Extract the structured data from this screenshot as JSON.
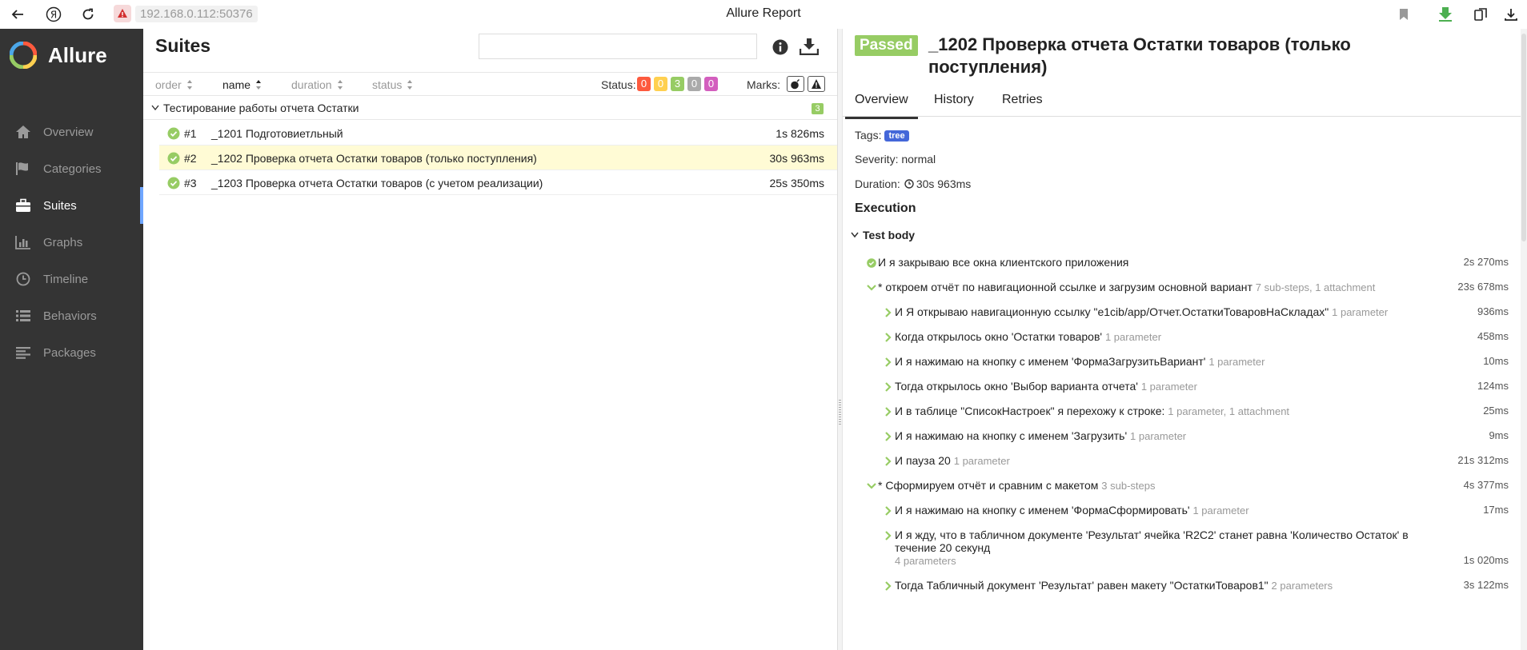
{
  "browser": {
    "address": "192.168.0.112:50376",
    "page_title": "Allure Report"
  },
  "sidebar": {
    "logo": "Allure",
    "items": [
      {
        "label": "Overview",
        "icon": "home-icon"
      },
      {
        "label": "Categories",
        "icon": "flag-icon"
      },
      {
        "label": "Suites",
        "icon": "briefcase-icon",
        "active": true
      },
      {
        "label": "Graphs",
        "icon": "bar-chart-icon"
      },
      {
        "label": "Timeline",
        "icon": "clock-icon"
      },
      {
        "label": "Behaviors",
        "icon": "list-icon"
      },
      {
        "label": "Packages",
        "icon": "align-left-icon"
      }
    ]
  },
  "suites": {
    "title": "Suites",
    "search_placeholder": "",
    "sort": {
      "order": "order",
      "name": "name",
      "duration": "duration",
      "status": "status"
    },
    "status_label": "Status:",
    "status_counts": [
      {
        "value": "0",
        "color": "#fd5a3e"
      },
      {
        "value": "0",
        "color": "#ffd050"
      },
      {
        "value": "3",
        "color": "#97cc64"
      },
      {
        "value": "0",
        "color": "#aaaaaa"
      },
      {
        "value": "0",
        "color": "#d35ebe"
      }
    ],
    "marks_label": "Marks:",
    "group": {
      "title": "Тестирование работы отчета Остатки",
      "count": "3"
    },
    "tests": [
      {
        "num": "#1",
        "name": "_1201 Подготовиетльный",
        "duration": "1s 826ms"
      },
      {
        "num": "#2",
        "name": "_1202 Проверка отчета Остатки товаров (только поступления)",
        "duration": "30s 963ms"
      },
      {
        "num": "#3",
        "name": "_1203 Проверка отчета Остатки товаров (с учетом реализации)",
        "duration": "25s 350ms"
      }
    ]
  },
  "result": {
    "status": "Passed",
    "title": "_1202 Проверка отчета Остатки товаров (только поступления)",
    "tabs": [
      "Overview",
      "History",
      "Retries"
    ],
    "tags_label": "Tags:",
    "tag": "tree",
    "severity": "Severity: normal",
    "duration_label": "Duration:",
    "duration": "30s 963ms",
    "execution": "Execution",
    "test_body": "Test body",
    "steps": [
      {
        "text": "И я закрываю все окна клиентского приложения",
        "sub": "",
        "dur": "2s 270ms"
      },
      {
        "text": "* откроем отчёт по навигационной ссылке и загрузим основной вариант",
        "sub": "7 sub-steps, 1 attachment",
        "dur": "23s 678ms"
      },
      {
        "text": "И Я открываю навигационную ссылку \"e1cib/app/Отчет.ОстаткиТоваровНаСкладах\"",
        "sub": "1 parameter",
        "dur": "936ms"
      },
      {
        "text": "Когда открылось окно 'Остатки товаров'",
        "sub": "1 parameter",
        "dur": "458ms"
      },
      {
        "text": "И я нажимаю на кнопку с именем 'ФормаЗагрузитьВариант'",
        "sub": "1 parameter",
        "dur": "10ms"
      },
      {
        "text": "Тогда открылось окно 'Выбор варианта отчета'",
        "sub": "1 parameter",
        "dur": "124ms"
      },
      {
        "text": "И в таблице \"СписокНастроек\" я перехожу к строке:",
        "sub": "1 parameter, 1 attachment",
        "dur": "25ms"
      },
      {
        "text": "И я нажимаю на кнопку с именем 'Загрузить'",
        "sub": "1 parameter",
        "dur": "9ms"
      },
      {
        "text": "И пауза 20",
        "sub": "1 parameter",
        "dur": "21s 312ms"
      },
      {
        "text": "* Сформируем отчёт и сравним с макетом",
        "sub": "3 sub-steps",
        "dur": "4s 377ms"
      },
      {
        "text": "И я нажимаю на кнопку с именем 'ФормаСформировать'",
        "sub": "1 parameter",
        "dur": "17ms"
      },
      {
        "text": "И я жду, что в табличном документе 'Результат' ячейка 'R2C2' станет равна 'Количество Остаток' в течение 20 секунд",
        "sub": "4 parameters",
        "dur": "1s 020ms"
      },
      {
        "text": "Тогда Табличный документ 'Результат' равен макету \"ОстаткиТоваров1\"",
        "sub": "2 parameters",
        "dur": "3s 122ms"
      }
    ]
  }
}
